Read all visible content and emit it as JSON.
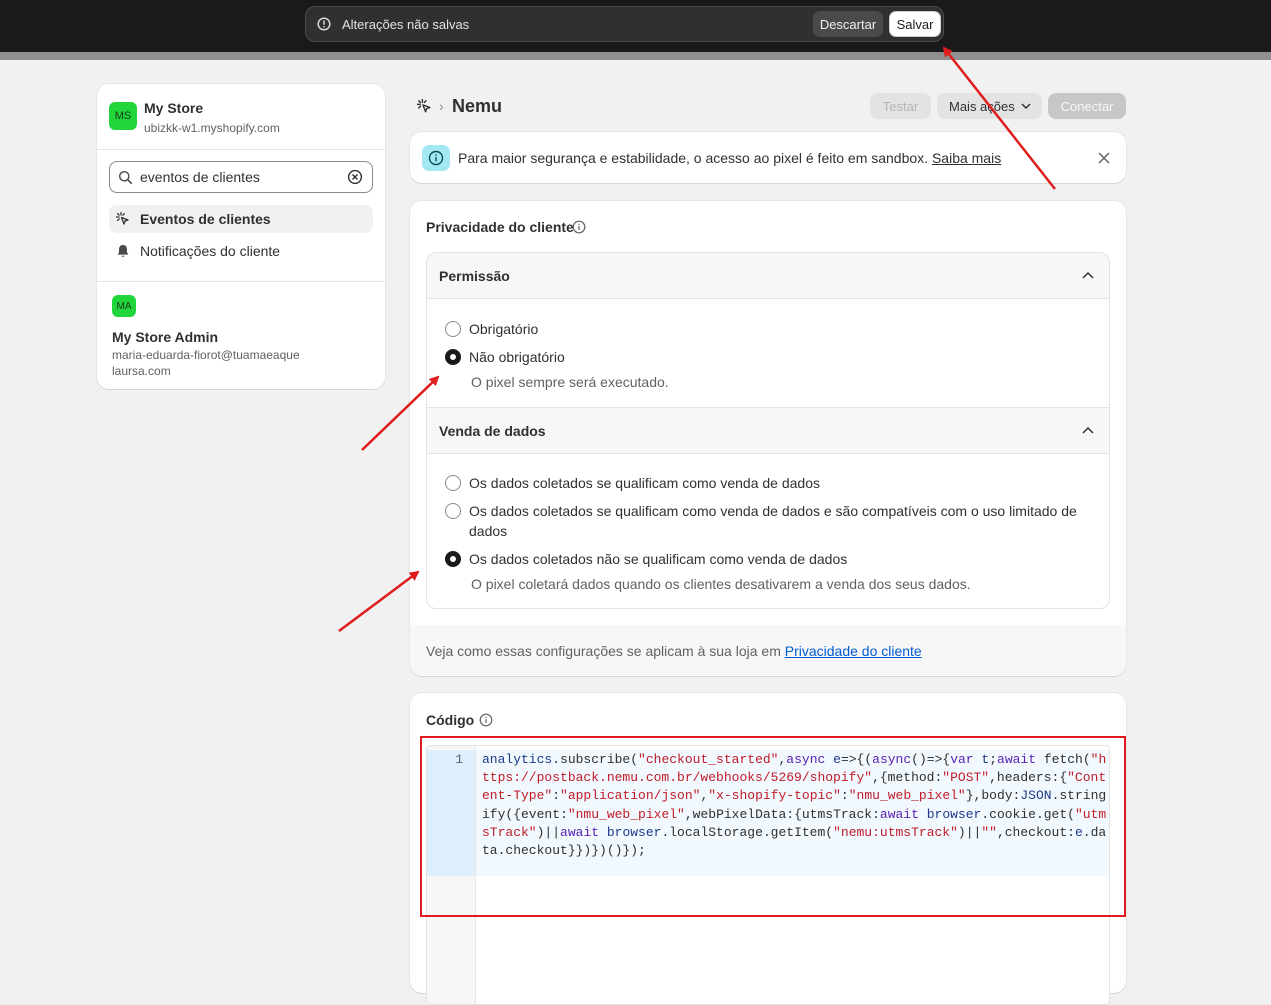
{
  "savebar": {
    "message": "Alterações não salvas",
    "discard_label": "Descartar",
    "save_label": "Salvar"
  },
  "sidebar": {
    "store": {
      "initials": "MS",
      "name": "My Store",
      "domain": "ubizkk-w1.myshopify.com"
    },
    "search": {
      "value": "eventos de clientes"
    },
    "items": [
      {
        "label": "Eventos de clientes",
        "icon": "cursor-sparkle-icon",
        "active": true
      },
      {
        "label": "Notificações do cliente",
        "icon": "bell-icon",
        "active": false
      }
    ],
    "user": {
      "initials": "MA",
      "name": "My Store Admin",
      "email": "maria-eduarda-fiorot@tuamaeaquelaursa.com"
    }
  },
  "header": {
    "breadcrumb_icon": "cursor-sparkle-icon",
    "title": "Nemu",
    "test_label": "Testar",
    "more_label": "Mais ações",
    "connect_label": "Conectar"
  },
  "banner": {
    "text": "Para maior segurança e estabilidade, o acesso ao pixel é feito em sandbox.",
    "link": "Saiba mais"
  },
  "privacy": {
    "title": "Privacidade do cliente",
    "permission": {
      "heading": "Permissão",
      "options": [
        "Obrigatório",
        "Não obrigatório"
      ],
      "selected": 1,
      "help": "O pixel sempre será executado."
    },
    "data_sale": {
      "heading": "Venda de dados",
      "options": [
        "Os dados coletados se qualificam como venda de dados",
        "Os dados coletados se qualificam como venda de dados e são compatíveis com o uso limitado de dados",
        "Os dados coletados não se qualificam como venda de dados"
      ],
      "selected": 2,
      "help": "O pixel coletará dados quando os clientes desativarem a venda dos seus dados."
    },
    "footer_text": "Veja como essas configurações se aplicam à sua loja em",
    "footer_link": "Privacidade do cliente"
  },
  "code": {
    "title": "Código",
    "line_number": "1",
    "content": "analytics.subscribe(\"checkout_started\",async e=>{(async()=>{var t;await fetch(\"https://postback.nemu.com.br/webhooks/5269/shopify\",{method:\"POST\",headers:{\"Content-Type\":\"application/json\",\"x-shopify-topic\":\"nmu_web_pixel\"},body:JSON.stringify({event:\"nmu_web_pixel\",webPixelData:{utmsTrack:await browser.cookie.get(\"utmsTrack\")||await browser.localStorage.getItem(\"nemu:utmsTrack\")||\"\",checkout:e.data.checkout}})})()});"
  },
  "colors": {
    "annotation": "#e01b1b",
    "avatar": "#21d63b",
    "link": "#005bd3"
  }
}
